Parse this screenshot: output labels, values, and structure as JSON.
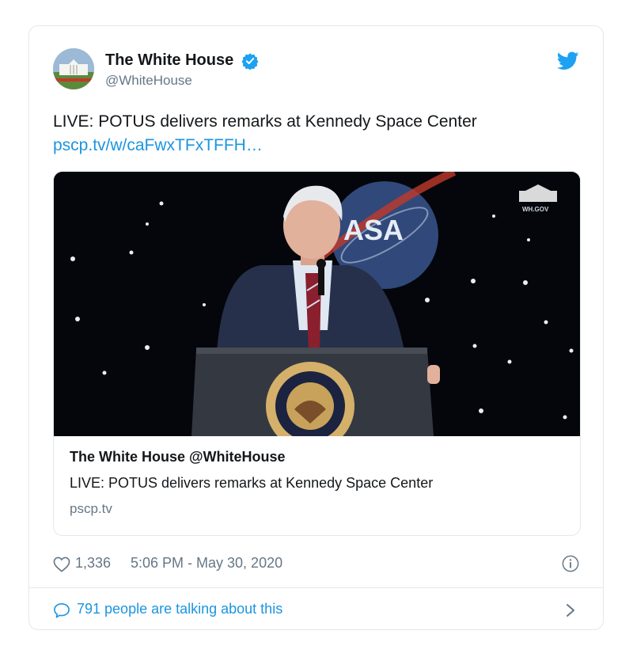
{
  "tweet": {
    "author": {
      "display_name": "The White House",
      "handle": "@WhiteHouse",
      "verified": true
    },
    "text": "LIVE: POTUS delivers remarks at Kennedy Space Center",
    "link": "pscp.tv/w/caFwxTFxTFFH…",
    "card": {
      "media": {
        "agency_logo_text": "ASA",
        "watermark": "WH.GOV",
        "seal_text": "PRESIDENT OF THE UNITED"
      },
      "title": "The White House @WhiteHouse",
      "description": "LIVE: POTUS delivers remarks at Kennedy Space Center",
      "domain": "pscp.tv"
    },
    "likes": "1,336",
    "timestamp": "5:06 PM - May 30, 2020",
    "conversation": "791 people are talking about this"
  },
  "icons": {
    "verified": "verified-badge-icon",
    "brand": "twitter-bird-icon",
    "like": "heart-icon",
    "info": "info-icon",
    "reply": "speech-bubble-icon",
    "more": "chevron-right-icon"
  },
  "colors": {
    "link": "#1b95e0",
    "muted": "#657786",
    "text": "#14171a",
    "border": "#e1e8ed"
  }
}
